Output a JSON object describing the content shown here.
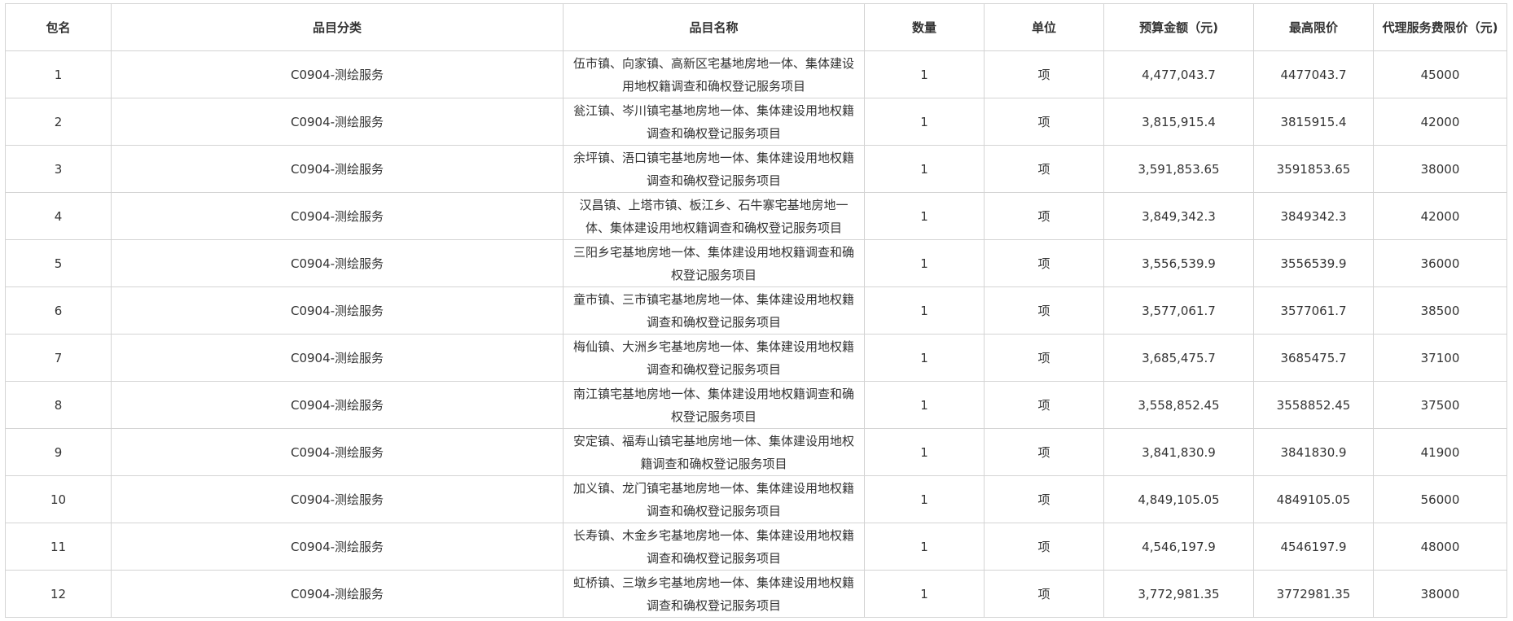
{
  "table": {
    "headers": {
      "package": "包名",
      "category": "品目分类",
      "item_name": "品目名称",
      "quantity": "数量",
      "unit": "单位",
      "budget": "预算金额（元)",
      "max_price": "最高限价",
      "agency_fee": "代理服务费限价（元)"
    },
    "rows": [
      {
        "package": "1",
        "category": "C0904-测绘服务",
        "item_name": "伍市镇、向家镇、高新区宅基地房地一体、集体建设用地权籍调查和确权登记服务项目",
        "quantity": "1",
        "unit": "项",
        "budget": "4,477,043.7",
        "max_price": "4477043.7",
        "agency_fee": "45000"
      },
      {
        "package": "2",
        "category": "C0904-测绘服务",
        "item_name": "瓮江镇、岑川镇宅基地房地一体、集体建设用地权籍调查和确权登记服务项目",
        "quantity": "1",
        "unit": "项",
        "budget": "3,815,915.4",
        "max_price": "3815915.4",
        "agency_fee": "42000"
      },
      {
        "package": "3",
        "category": "C0904-测绘服务",
        "item_name": "余坪镇、浯口镇宅基地房地一体、集体建设用地权籍调查和确权登记服务项目",
        "quantity": "1",
        "unit": "项",
        "budget": "3,591,853.65",
        "max_price": "3591853.65",
        "agency_fee": "38000"
      },
      {
        "package": "4",
        "category": "C0904-测绘服务",
        "item_name": "汉昌镇、上塔市镇、板江乡、石牛寨宅基地房地一体、集体建设用地权籍调查和确权登记服务项目",
        "quantity": "1",
        "unit": "项",
        "budget": "3,849,342.3",
        "max_price": "3849342.3",
        "agency_fee": "42000"
      },
      {
        "package": "5",
        "category": "C0904-测绘服务",
        "item_name": "三阳乡宅基地房地一体、集体建设用地权籍调查和确权登记服务项目",
        "quantity": "1",
        "unit": "项",
        "budget": "3,556,539.9",
        "max_price": "3556539.9",
        "agency_fee": "36000"
      },
      {
        "package": "6",
        "category": "C0904-测绘服务",
        "item_name": "童市镇、三市镇宅基地房地一体、集体建设用地权籍调查和确权登记服务项目",
        "quantity": "1",
        "unit": "项",
        "budget": "3,577,061.7",
        "max_price": "3577061.7",
        "agency_fee": "38500"
      },
      {
        "package": "7",
        "category": "C0904-测绘服务",
        "item_name": "梅仙镇、大洲乡宅基地房地一体、集体建设用地权籍调查和确权登记服务项目",
        "quantity": "1",
        "unit": "项",
        "budget": "3,685,475.7",
        "max_price": "3685475.7",
        "agency_fee": "37100"
      },
      {
        "package": "8",
        "category": "C0904-测绘服务",
        "item_name": "南江镇宅基地房地一体、集体建设用地权籍调查和确权登记服务项目",
        "quantity": "1",
        "unit": "项",
        "budget": "3,558,852.45",
        "max_price": "3558852.45",
        "agency_fee": "37500"
      },
      {
        "package": "9",
        "category": "C0904-测绘服务",
        "item_name": "安定镇、福寿山镇宅基地房地一体、集体建设用地权籍调查和确权登记服务项目",
        "quantity": "1",
        "unit": "项",
        "budget": "3,841,830.9",
        "max_price": "3841830.9",
        "agency_fee": "41900"
      },
      {
        "package": "10",
        "category": "C0904-测绘服务",
        "item_name": "加义镇、龙门镇宅基地房地一体、集体建设用地权籍调查和确权登记服务项目",
        "quantity": "1",
        "unit": "项",
        "budget": "4,849,105.05",
        "max_price": "4849105.05",
        "agency_fee": "56000"
      },
      {
        "package": "11",
        "category": "C0904-测绘服务",
        "item_name": "长寿镇、木金乡宅基地房地一体、集体建设用地权籍调查和确权登记服务项目",
        "quantity": "1",
        "unit": "项",
        "budget": "4,546,197.9",
        "max_price": "4546197.9",
        "agency_fee": "48000"
      },
      {
        "package": "12",
        "category": "C0904-测绘服务",
        "item_name": "虹桥镇、三墩乡宅基地房地一体、集体建设用地权籍调查和确权登记服务项目",
        "quantity": "1",
        "unit": "项",
        "budget": "3,772,981.35",
        "max_price": "3772981.35",
        "agency_fee": "38000"
      }
    ]
  }
}
